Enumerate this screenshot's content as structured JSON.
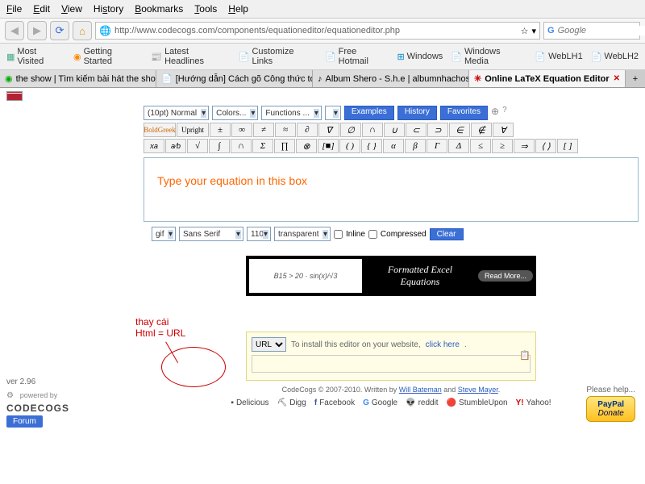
{
  "menu": [
    "File",
    "Edit",
    "View",
    "History",
    "Bookmarks",
    "Tools",
    "Help"
  ],
  "url": "http://www.codecogs.com/components/equationeditor/equationeditor.php",
  "search_placeholder": "Google",
  "bookmarks": [
    "Most Visited",
    "Getting Started",
    "Latest Headlines",
    "Customize Links",
    "Free Hotmail",
    "Windows",
    "Windows Media",
    "WebLH1",
    "WebLH2"
  ],
  "tabs": [
    {
      "label": "the show | Tìm kiếm bài hát the show"
    },
    {
      "label": "[Hướng dẫn] Cách gõ Công thức toán..."
    },
    {
      "label": "Album Shero - S.h.e | albumnhachos..."
    },
    {
      "label": "Online LaTeX Equation Editor"
    }
  ],
  "editor": {
    "size": "(10pt) Normal",
    "colors": "Colors...",
    "functions": "Functions ...",
    "tabs": [
      "Examples",
      "History",
      "Favorites"
    ],
    "boldgreek": "BoldGreek",
    "upright": "Upright",
    "placeholder": "Type your equation in this box"
  },
  "output": {
    "format": "gif",
    "font": "Sans Serif",
    "dpi": "110",
    "bg": "transparent",
    "inline": "Inline",
    "compressed": "Compressed",
    "clear": "Clear"
  },
  "ad": {
    "text": "Formatted Excel Equations",
    "btn": "Read More..."
  },
  "annotation": {
    "line1": "thay cái",
    "line2": "Html = URL"
  },
  "sidebar": {
    "version": "ver 2.96",
    "powered": "powered by",
    "cogs": "CODECOGS",
    "forum": "Forum"
  },
  "donate": {
    "help": "Please help...",
    "paypal": "PayPal",
    "donate": "Donate"
  },
  "install": {
    "select": "URL",
    "text": "To install this editor on your website,",
    "click": "click here"
  },
  "footer": {
    "copyright": "CodeCogs © 2007-2010. Written by ",
    "author1": "Will Bateman",
    "and": " and ",
    "author2": "Steve Mayer"
  },
  "social": [
    "Delicious",
    "Digg",
    "Facebook",
    "Google",
    "reddit",
    "StumbleUpon",
    "Yahoo!"
  ]
}
